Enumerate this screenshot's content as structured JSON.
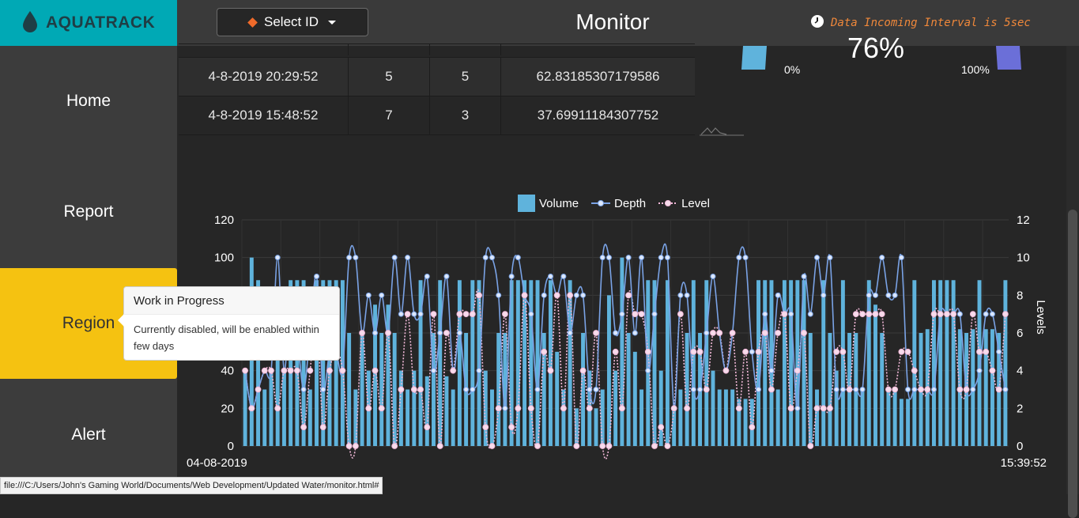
{
  "app": {
    "brand": "AQUATRACK",
    "page_title": "Monitor",
    "interval_text": "Data Incoming Interval is 5sec"
  },
  "toolbar": {
    "select_label": "Select ID"
  },
  "sidebar": {
    "items": [
      {
        "label": "Home",
        "active": false
      },
      {
        "label": "Report",
        "active": false
      },
      {
        "label": "Region",
        "active": true
      },
      {
        "label": "Alert",
        "active": false
      }
    ]
  },
  "table": {
    "rows": [
      [
        "4-8-2019 20:29:52",
        "5",
        "5",
        "62.83185307179586"
      ],
      [
        "4-8-2019 15:48:52",
        "7",
        "3",
        "37.69911184307752"
      ]
    ]
  },
  "gauge": {
    "value": "76%",
    "left_min": "0%",
    "right_max": "100%",
    "left_color": "#5fb3dc",
    "right_color": "#6b6fd8"
  },
  "tooltip": {
    "title": "Work in Progress",
    "body": "Currently disabled, will be enabled within few days"
  },
  "statusbar": {
    "url": "file:///C:/Users/John's Gaming World/Documents/Web Development/Updated Water/monitor.html#"
  },
  "chart_data": {
    "type": "bar",
    "legend": [
      "Volume",
      "Depth",
      "Level"
    ],
    "legend_position": "top",
    "grid": true,
    "y_left": {
      "ticks": [
        "0",
        "20",
        "40",
        "60",
        "80",
        "100",
        "120"
      ],
      "ylim": [
        0,
        120
      ]
    },
    "y_right": {
      "label": "Levels",
      "ticks": [
        "0",
        "2",
        "4",
        "6",
        "8",
        "10",
        "12"
      ],
      "ylim": [
        0,
        12
      ]
    },
    "x_first_label": "04-08-2019",
    "x_last_label": "15:39:52",
    "colors": {
      "volume": "#5fb3dc",
      "depth": "#7aa3e6",
      "level": "#f2b8d8"
    },
    "series": [
      {
        "name": "Volume",
        "axis": "left",
        "values": [
          40,
          100,
          88,
          30,
          40,
          80,
          40,
          88,
          88,
          88,
          30,
          88,
          88,
          88,
          88,
          88,
          60,
          30,
          60,
          40,
          75,
          60,
          75,
          60,
          40,
          30,
          40,
          88,
          37,
          60,
          88,
          37,
          30,
          88,
          60,
          88,
          88,
          40,
          30,
          60,
          60,
          88,
          88,
          88,
          88,
          88,
          60,
          88,
          50,
          30,
          88,
          20,
          60,
          40,
          20,
          30,
          80,
          40,
          100,
          60,
          50,
          30,
          88,
          88,
          40,
          88,
          20,
          30,
          60,
          88,
          60,
          88,
          40,
          30,
          30,
          30,
          25,
          25,
          25,
          88,
          88,
          88,
          30,
          88,
          88,
          88,
          88,
          60,
          30,
          88,
          60,
          40,
          88,
          60,
          60,
          30,
          88,
          75,
          60,
          30,
          30,
          25,
          25,
          88,
          60,
          62,
          88,
          88,
          88,
          88,
          62,
          60,
          62,
          88,
          62,
          62,
          60,
          88
        ]
      },
      {
        "name": "Depth",
        "axis": "left",
        "values": [
          40,
          20,
          30,
          40,
          40,
          100,
          40,
          80,
          60,
          30,
          60,
          90,
          30,
          50,
          50,
          40,
          100,
          100,
          60,
          80,
          60,
          80,
          60,
          100,
          70,
          100,
          70,
          70,
          90,
          40,
          60,
          90,
          40,
          60,
          30,
          30,
          40,
          100,
          100,
          80,
          20,
          90,
          100,
          80,
          70,
          30,
          80,
          90,
          80,
          90,
          60,
          80,
          80,
          30,
          30,
          100,
          100,
          60,
          70,
          100,
          60,
          100,
          40,
          70,
          100,
          100,
          20,
          80,
          80,
          30,
          30,
          60,
          90,
          60,
          40,
          60,
          100,
          100,
          50,
          30,
          70,
          40,
          80,
          70,
          70,
          20,
          90,
          70,
          100,
          80,
          100,
          30,
          30,
          30,
          30,
          30,
          80,
          80,
          100,
          80,
          80,
          100,
          30,
          30,
          30,
          30,
          30,
          70,
          70,
          70,
          70,
          30,
          30,
          40,
          70,
          70,
          50,
          30
        ]
      },
      {
        "name": "Level",
        "axis": "right",
        "values": [
          4,
          2,
          3,
          4,
          4,
          2,
          4,
          4,
          4,
          1,
          4,
          7,
          1,
          4,
          5,
          4,
          0,
          0,
          6,
          2,
          4,
          2,
          6,
          0,
          3,
          7,
          3,
          3,
          1,
          7,
          0,
          6,
          4,
          7,
          7,
          7,
          8,
          1,
          0,
          2,
          7,
          1,
          2,
          8,
          2,
          0,
          5,
          4,
          8,
          2,
          8,
          0,
          4,
          2,
          6,
          0,
          0,
          5,
          2,
          8,
          7,
          7,
          5,
          0,
          1,
          0,
          2,
          7,
          2,
          5,
          5,
          3,
          6,
          6,
          4,
          6,
          2,
          5,
          1,
          5,
          6,
          3,
          6,
          7,
          2,
          4,
          6,
          0,
          2,
          2,
          2,
          5,
          5,
          3,
          7,
          7,
          7,
          7,
          7,
          3,
          3,
          5,
          5,
          4,
          3,
          3,
          7,
          7,
          7,
          7,
          3,
          3,
          7,
          5,
          5,
          4,
          3,
          7
        ]
      }
    ]
  }
}
